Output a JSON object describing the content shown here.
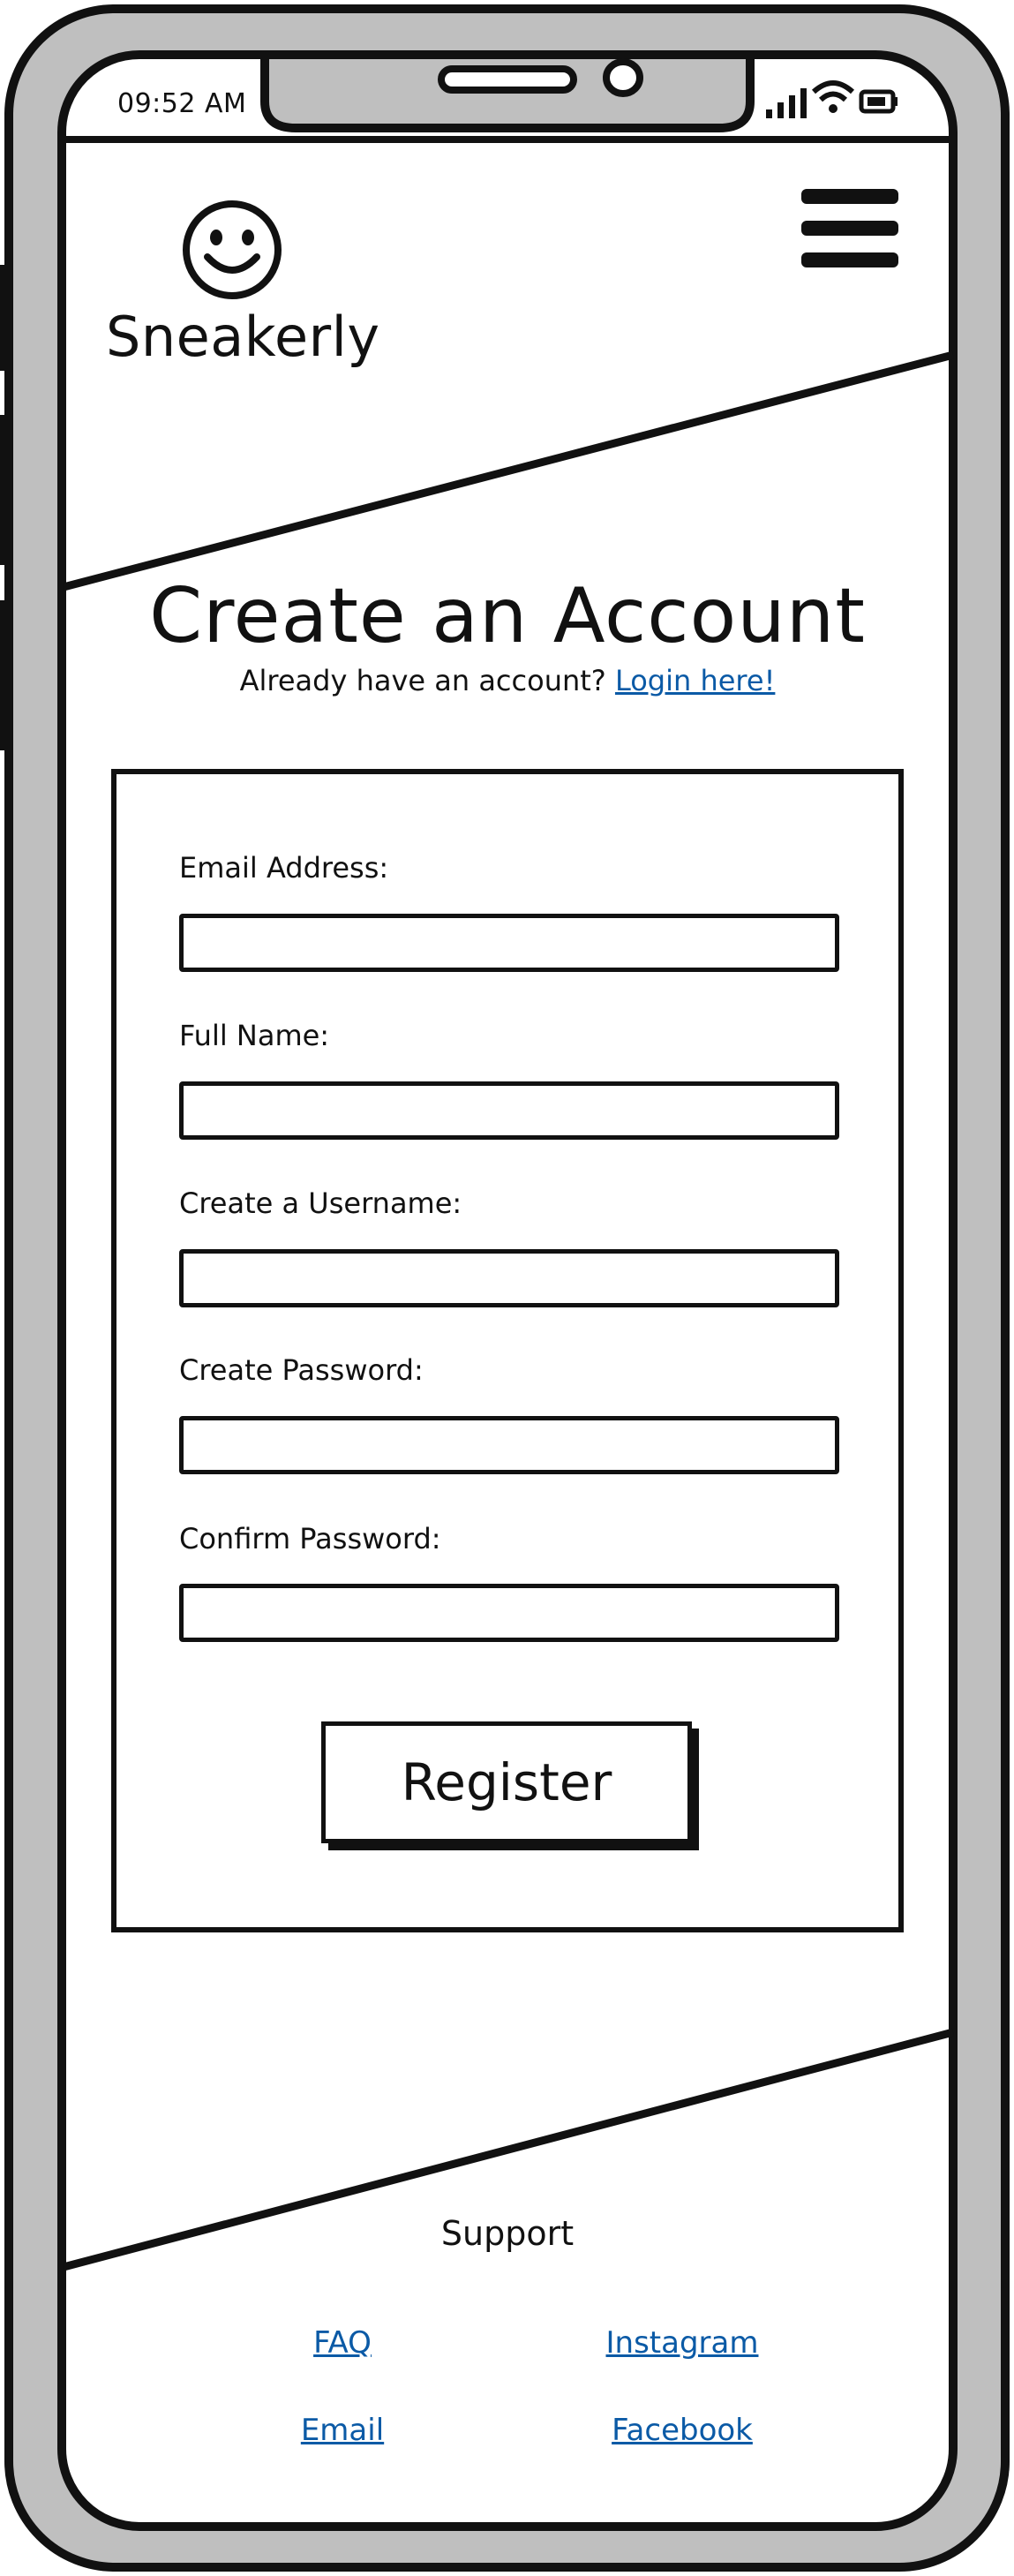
{
  "status_bar": {
    "time": "09:52 AM"
  },
  "header": {
    "brand": "Sneakerly",
    "logo_icon": "smiley-face-icon",
    "menu_icon": "hamburger-menu-icon"
  },
  "page": {
    "title": "Create an Account",
    "subtitle_text": "Already have an account?",
    "login_link": "Login here!"
  },
  "form": {
    "fields": [
      {
        "label": "Email Address:",
        "value": ""
      },
      {
        "label": "Full Name:",
        "value": ""
      },
      {
        "label": "Create a Username:",
        "value": ""
      },
      {
        "label": "Create Password:",
        "value": ""
      },
      {
        "label": "Confirm Password:",
        "value": ""
      }
    ],
    "submit_label": "Register"
  },
  "footer": {
    "heading": "Support",
    "links": [
      "FAQ",
      "Instagram",
      "Email",
      "Facebook"
    ]
  },
  "colors": {
    "link": "#0b5aa6",
    "frame": "#bfbfbf",
    "ink": "#111111"
  }
}
